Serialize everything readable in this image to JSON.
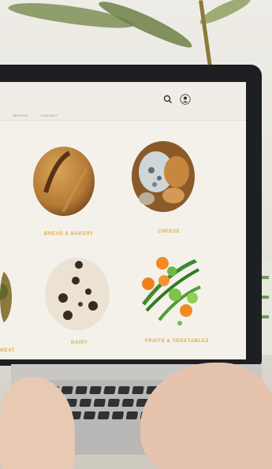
{
  "nav": {
    "item1": "SERVICE",
    "item2": "CONTACT"
  },
  "header_icons": {
    "search": "search-icon",
    "user": "user-icon"
  },
  "tiles": [
    {
      "caption": "BREAD & BAKERY",
      "image": "bread-image"
    },
    {
      "caption": "CHEESE",
      "image": "cheese-image"
    },
    {
      "caption": "",
      "image": "partial-tile-image"
    },
    {
      "caption": "DAIRY",
      "image": "cookies-cream-image"
    },
    {
      "caption": "FRUITS & VEGETABLES",
      "image": "vegetables-image"
    }
  ],
  "partial_caption_left": "MEAT",
  "colors": {
    "accent": "#e0a94a",
    "screen_bg": "#f4f1ea"
  }
}
